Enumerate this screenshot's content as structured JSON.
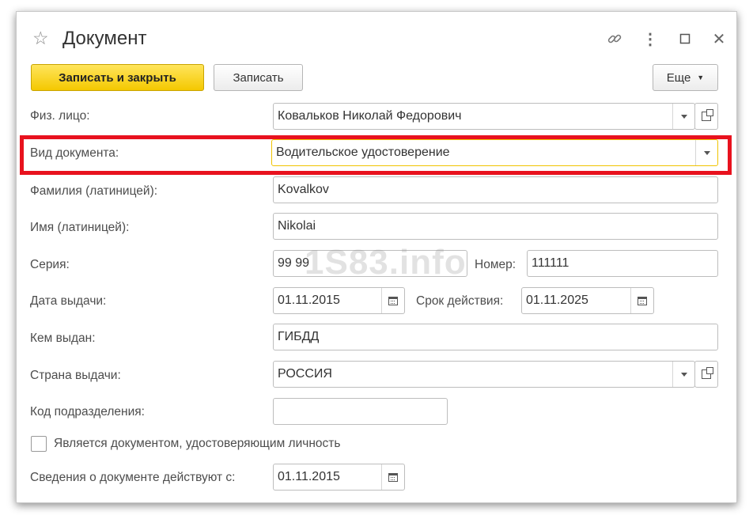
{
  "window": {
    "title": "Документ"
  },
  "toolbar": {
    "save_close_label": "Записать и закрыть",
    "save_label": "Записать",
    "more_label": "Еще"
  },
  "form": {
    "person": {
      "label": "Физ. лицо:",
      "value": "Ковальков Николай Федорович"
    },
    "doc_type": {
      "label": "Вид документа:",
      "value": "Водительское удостоверение"
    },
    "surname_lat": {
      "label": "Фамилия (латиницей):",
      "value": "Kovalkov"
    },
    "name_lat": {
      "label": "Имя (латиницей):",
      "value": "Nikolai"
    },
    "series": {
      "label": "Серия:",
      "value": "99 99"
    },
    "number": {
      "label": "Номер:",
      "value": "111111"
    },
    "issue_date": {
      "label": "Дата выдачи:",
      "value": "01.11.2015"
    },
    "expiry": {
      "label": "Срок действия:",
      "value": "01.11.2025"
    },
    "issued_by": {
      "label": "Кем выдан:",
      "value": "ГИБДД"
    },
    "country": {
      "label": "Страна выдачи:",
      "value": "РОССИЯ"
    },
    "dept_code": {
      "label": "Код подразделения:",
      "value": ""
    },
    "is_identity": {
      "label": "Является документом, удостоверяющим личность",
      "checked": false
    },
    "valid_from": {
      "label": "Сведения о документе действуют с:",
      "value": "01.11.2015"
    }
  },
  "watermark": "1S83.info",
  "colors": {
    "primary_button": "#f4c800",
    "highlight": "#e8121e"
  },
  "icons": [
    "star-icon",
    "link-icon",
    "more-vert-icon",
    "maximize-icon",
    "close-icon",
    "dropdown-icon",
    "calendar-icon",
    "open-icon"
  ]
}
